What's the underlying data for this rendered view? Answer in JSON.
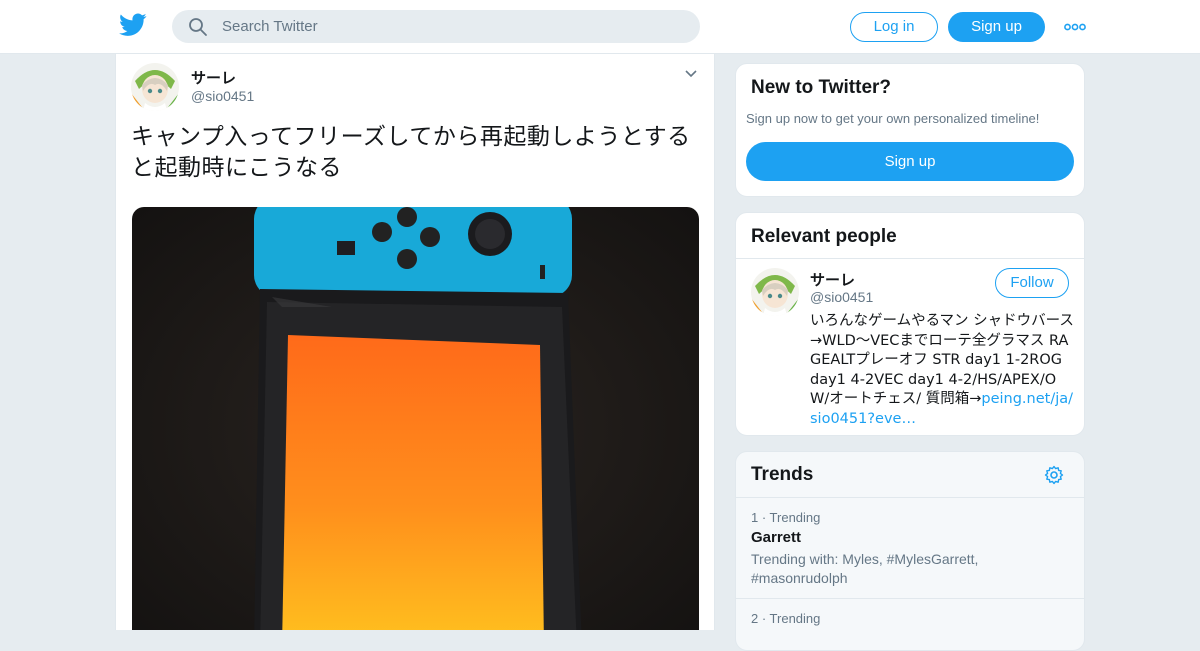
{
  "header": {
    "search_placeholder": "Search Twitter",
    "login_label": "Log in",
    "signup_label": "Sign up",
    "brand_color": "#1da1f2"
  },
  "tweet": {
    "author_name": "サーレ",
    "author_handle": "@sio0451",
    "text": "キャンプ入ってフリーズしてから再起動しようとすると起動時にこうなる",
    "photo_description_icon": "nintendo-switch-photo"
  },
  "new_to_twitter": {
    "title": "New to Twitter?",
    "subtitle": "Sign up now to get your own personalized timeline!",
    "button_label": "Sign up"
  },
  "relevant_people": {
    "title": "Relevant people",
    "person": {
      "name": "サーレ",
      "handle": "@sio0451",
      "follow_label": "Follow",
      "bio_text": "いろんなゲームやるマン シャドウバース→WLD～VECまでローテ全グラマス RAGEALTプレーオフ STR day1 1-2ROG day1 4-2VEC day1 4-2/HS/APEX/OW/オートチェス/ 質問箱→",
      "bio_link": "peing.net/ja/sio0451?eve…"
    }
  },
  "trends": {
    "title": "Trends",
    "items": [
      {
        "rank_label": "1 · Trending",
        "name": "Garrett",
        "with": "Trending with: Myles, #MylesGarrett, #masonrudolph"
      },
      {
        "rank_label": "2 · Trending",
        "name": "",
        "with": ""
      }
    ]
  }
}
